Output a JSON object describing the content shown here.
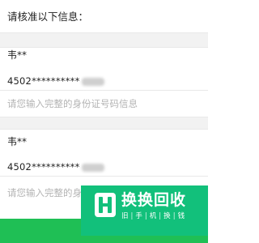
{
  "form": {
    "heading": "请核准以下信息：",
    "persons": [
      {
        "name": "韦**",
        "id_number": "4502**********",
        "id_placeholder": "请您输入完整的身份证号码信息"
      },
      {
        "name": "韦**",
        "id_number": "4502**********",
        "id_placeholder": "请您输入完整的身"
      }
    ]
  },
  "watermark": {
    "brand": "换换回收",
    "slogan": [
      "旧",
      "手",
      "机",
      "换",
      "钱"
    ],
    "icon": "h-logo-icon"
  },
  "colors": {
    "watermark_green": "#12c07b",
    "button_green": "#1fbf55",
    "placeholder_gray": "#b3b3b3",
    "divider": "#e9e9e9"
  }
}
